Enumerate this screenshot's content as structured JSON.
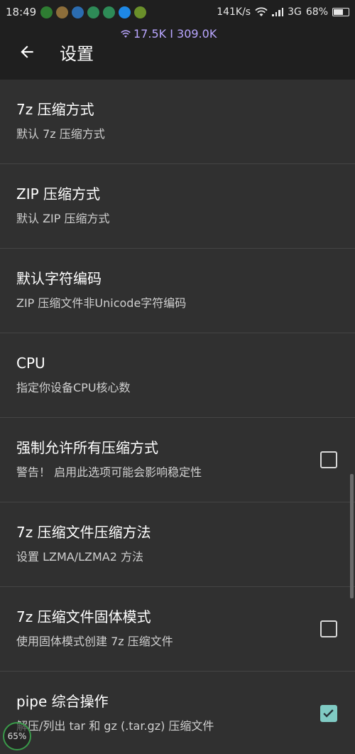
{
  "status_bar": {
    "time": "18:49",
    "net_rate": "141K/s",
    "network_type": "3G",
    "battery": "68%",
    "battery_level": 0.68,
    "notification_icons": [
      {
        "name": "app-icon-1",
        "color": "#2e7d32"
      },
      {
        "name": "app-icon-2",
        "color": "#8d6e3a"
      },
      {
        "name": "app-icon-3",
        "color": "#2b6cb0"
      },
      {
        "name": "app-icon-4",
        "color": "#2e8b57"
      },
      {
        "name": "app-icon-5",
        "color": "#2e8b57"
      },
      {
        "name": "app-icon-6",
        "color": "#1e88e5"
      },
      {
        "name": "app-icon-7",
        "color": "#6a8f2a"
      }
    ]
  },
  "overlay": {
    "net_speed": "17.5K I 309.0K"
  },
  "app_bar": {
    "title": "设置"
  },
  "settings": [
    {
      "title": "7z 压缩方式",
      "subtitle": "默认 7z 压缩方式",
      "checkbox": null
    },
    {
      "title": "ZIP 压缩方式",
      "subtitle": "默认 ZIP 压缩方式",
      "checkbox": null
    },
    {
      "title": "默认字符编码",
      "subtitle": "ZIP 压缩文件非Unicode字符编码",
      "checkbox": null
    },
    {
      "title": "CPU",
      "subtitle": "指定你设备CPU核心数",
      "checkbox": null
    },
    {
      "title": "强制允许所有压缩方式",
      "subtitle": "警告！ 启用此选项可能会影响稳定性",
      "checkbox": false
    },
    {
      "title": "7z 压缩文件压缩方法",
      "subtitle": "设置 LZMA/LZMA2 方法",
      "checkbox": null
    },
    {
      "title": "7z 压缩文件固体模式",
      "subtitle": "使用固体模式创建 7z 压缩文件",
      "checkbox": false
    },
    {
      "title": "pipe 综合操作",
      "subtitle": "解压/列出 tar 和 gz (.tar.gz) 压缩文件",
      "checkbox": true
    }
  ],
  "floating_battery": "65%",
  "colors": {
    "background": "#303030",
    "app_bar": "#1f1f1f",
    "accent": "#80cbc4",
    "divider": "#444444"
  }
}
